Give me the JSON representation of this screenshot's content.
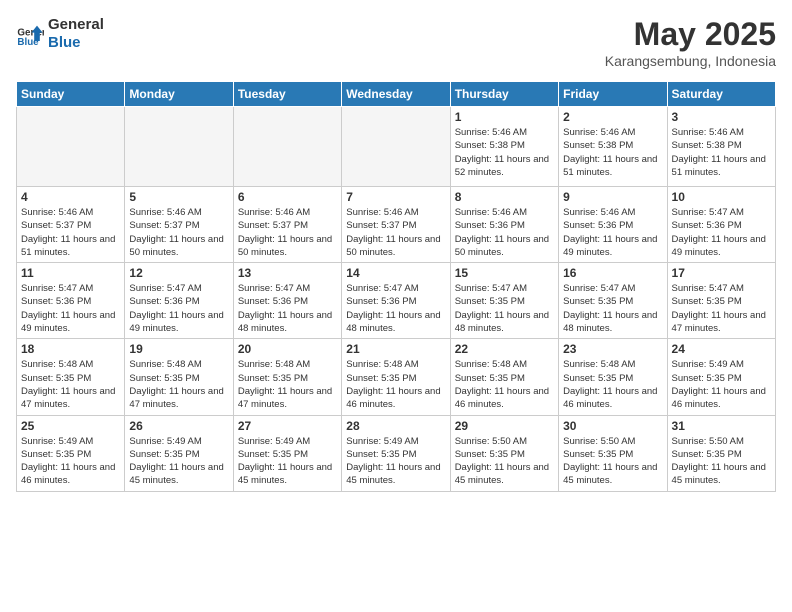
{
  "header": {
    "logo_line1": "General",
    "logo_line2": "Blue",
    "month_year": "May 2025",
    "location": "Karangsembung, Indonesia"
  },
  "weekdays": [
    "Sunday",
    "Monday",
    "Tuesday",
    "Wednesday",
    "Thursday",
    "Friday",
    "Saturday"
  ],
  "weeks": [
    [
      {
        "day": "",
        "info": ""
      },
      {
        "day": "",
        "info": ""
      },
      {
        "day": "",
        "info": ""
      },
      {
        "day": "",
        "info": ""
      },
      {
        "day": "1",
        "sunrise": "5:46 AM",
        "sunset": "5:38 PM",
        "daylight": "11 hours and 52 minutes."
      },
      {
        "day": "2",
        "sunrise": "5:46 AM",
        "sunset": "5:38 PM",
        "daylight": "11 hours and 51 minutes."
      },
      {
        "day": "3",
        "sunrise": "5:46 AM",
        "sunset": "5:38 PM",
        "daylight": "11 hours and 51 minutes."
      }
    ],
    [
      {
        "day": "4",
        "sunrise": "5:46 AM",
        "sunset": "5:37 PM",
        "daylight": "11 hours and 51 minutes."
      },
      {
        "day": "5",
        "sunrise": "5:46 AM",
        "sunset": "5:37 PM",
        "daylight": "11 hours and 50 minutes."
      },
      {
        "day": "6",
        "sunrise": "5:46 AM",
        "sunset": "5:37 PM",
        "daylight": "11 hours and 50 minutes."
      },
      {
        "day": "7",
        "sunrise": "5:46 AM",
        "sunset": "5:37 PM",
        "daylight": "11 hours and 50 minutes."
      },
      {
        "day": "8",
        "sunrise": "5:46 AM",
        "sunset": "5:36 PM",
        "daylight": "11 hours and 50 minutes."
      },
      {
        "day": "9",
        "sunrise": "5:46 AM",
        "sunset": "5:36 PM",
        "daylight": "11 hours and 49 minutes."
      },
      {
        "day": "10",
        "sunrise": "5:47 AM",
        "sunset": "5:36 PM",
        "daylight": "11 hours and 49 minutes."
      }
    ],
    [
      {
        "day": "11",
        "sunrise": "5:47 AM",
        "sunset": "5:36 PM",
        "daylight": "11 hours and 49 minutes."
      },
      {
        "day": "12",
        "sunrise": "5:47 AM",
        "sunset": "5:36 PM",
        "daylight": "11 hours and 49 minutes."
      },
      {
        "day": "13",
        "sunrise": "5:47 AM",
        "sunset": "5:36 PM",
        "daylight": "11 hours and 48 minutes."
      },
      {
        "day": "14",
        "sunrise": "5:47 AM",
        "sunset": "5:36 PM",
        "daylight": "11 hours and 48 minutes."
      },
      {
        "day": "15",
        "sunrise": "5:47 AM",
        "sunset": "5:35 PM",
        "daylight": "11 hours and 48 minutes."
      },
      {
        "day": "16",
        "sunrise": "5:47 AM",
        "sunset": "5:35 PM",
        "daylight": "11 hours and 48 minutes."
      },
      {
        "day": "17",
        "sunrise": "5:47 AM",
        "sunset": "5:35 PM",
        "daylight": "11 hours and 47 minutes."
      }
    ],
    [
      {
        "day": "18",
        "sunrise": "5:48 AM",
        "sunset": "5:35 PM",
        "daylight": "11 hours and 47 minutes."
      },
      {
        "day": "19",
        "sunrise": "5:48 AM",
        "sunset": "5:35 PM",
        "daylight": "11 hours and 47 minutes."
      },
      {
        "day": "20",
        "sunrise": "5:48 AM",
        "sunset": "5:35 PM",
        "daylight": "11 hours and 47 minutes."
      },
      {
        "day": "21",
        "sunrise": "5:48 AM",
        "sunset": "5:35 PM",
        "daylight": "11 hours and 46 minutes."
      },
      {
        "day": "22",
        "sunrise": "5:48 AM",
        "sunset": "5:35 PM",
        "daylight": "11 hours and 46 minutes."
      },
      {
        "day": "23",
        "sunrise": "5:48 AM",
        "sunset": "5:35 PM",
        "daylight": "11 hours and 46 minutes."
      },
      {
        "day": "24",
        "sunrise": "5:49 AM",
        "sunset": "5:35 PM",
        "daylight": "11 hours and 46 minutes."
      }
    ],
    [
      {
        "day": "25",
        "sunrise": "5:49 AM",
        "sunset": "5:35 PM",
        "daylight": "11 hours and 46 minutes."
      },
      {
        "day": "26",
        "sunrise": "5:49 AM",
        "sunset": "5:35 PM",
        "daylight": "11 hours and 45 minutes."
      },
      {
        "day": "27",
        "sunrise": "5:49 AM",
        "sunset": "5:35 PM",
        "daylight": "11 hours and 45 minutes."
      },
      {
        "day": "28",
        "sunrise": "5:49 AM",
        "sunset": "5:35 PM",
        "daylight": "11 hours and 45 minutes."
      },
      {
        "day": "29",
        "sunrise": "5:50 AM",
        "sunset": "5:35 PM",
        "daylight": "11 hours and 45 minutes."
      },
      {
        "day": "30",
        "sunrise": "5:50 AM",
        "sunset": "5:35 PM",
        "daylight": "11 hours and 45 minutes."
      },
      {
        "day": "31",
        "sunrise": "5:50 AM",
        "sunset": "5:35 PM",
        "daylight": "11 hours and 45 minutes."
      }
    ]
  ]
}
